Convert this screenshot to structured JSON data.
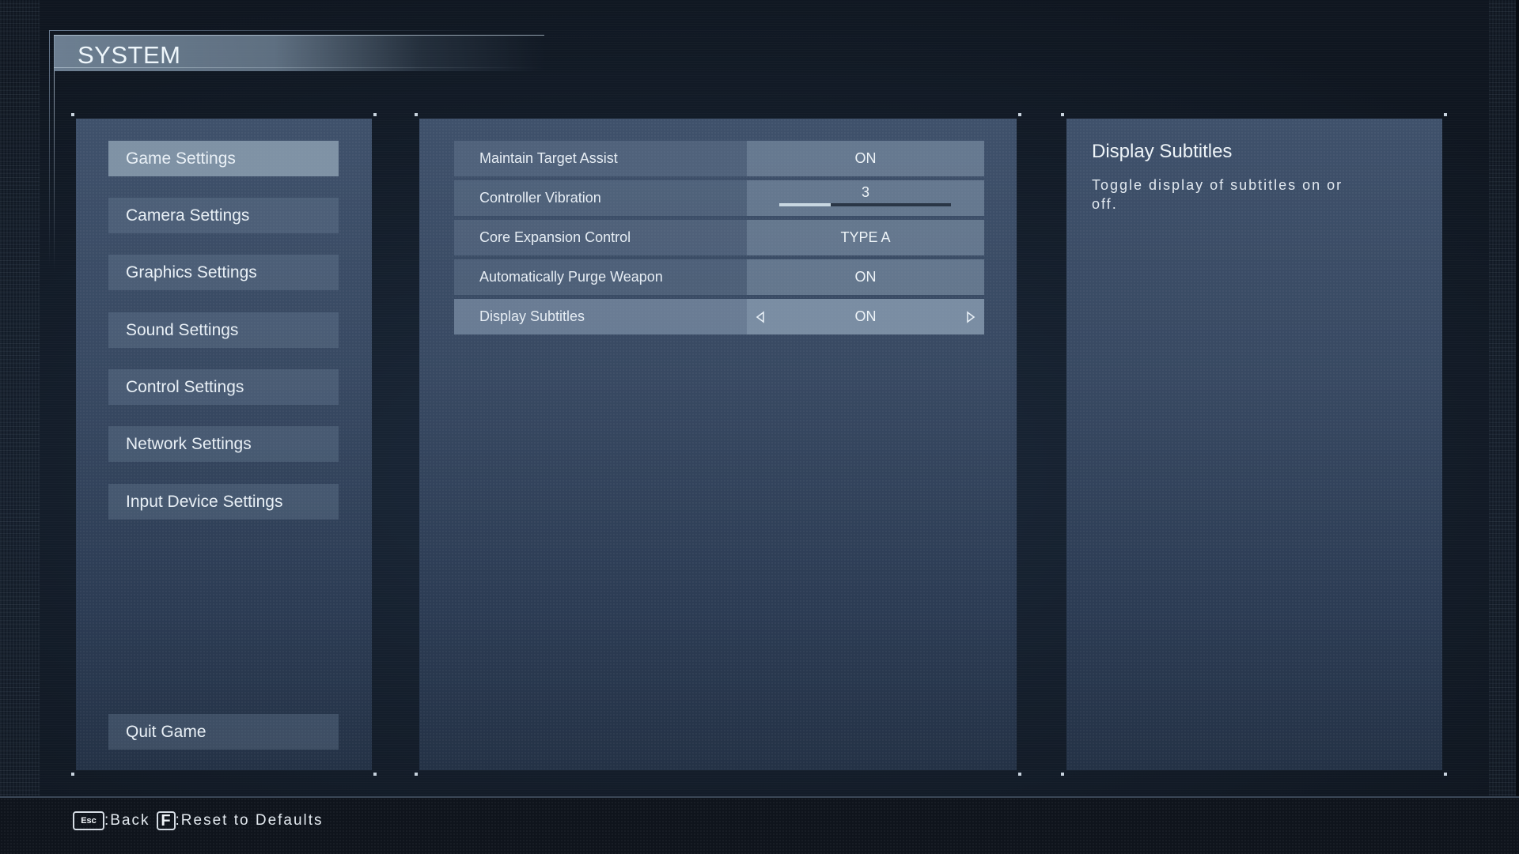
{
  "header": {
    "title": "SYSTEM"
  },
  "menu": {
    "items": [
      {
        "label": "Game Settings",
        "selected": true
      },
      {
        "label": "Camera Settings",
        "selected": false
      },
      {
        "label": "Graphics Settings",
        "selected": false
      },
      {
        "label": "Sound Settings",
        "selected": false
      },
      {
        "label": "Control Settings",
        "selected": false
      },
      {
        "label": "Network Settings",
        "selected": false
      },
      {
        "label": "Input Device Settings",
        "selected": false
      }
    ],
    "quit_label": "Quit Game"
  },
  "settings": {
    "rows": [
      {
        "label": "Maintain Target Assist",
        "type": "toggle",
        "value": "ON"
      },
      {
        "label": "Controller Vibration",
        "type": "slider",
        "value": "3",
        "level": 3,
        "max": 10
      },
      {
        "label": "Core Expansion Control",
        "type": "select",
        "value": "TYPE A"
      },
      {
        "label": "Automatically Purge Weapon",
        "type": "toggle",
        "value": "ON"
      },
      {
        "label": "Display Subtitles",
        "type": "toggle",
        "value": "ON",
        "selected": true
      }
    ],
    "arrow_left_icon": "triangle-left-outline",
    "arrow_right_icon": "triangle-right-outline"
  },
  "description": {
    "title": "Display Subtitles",
    "body": "Toggle display of subtitles on or off."
  },
  "footer": {
    "back_key": "Esc",
    "back_label": ":Back",
    "reset_key": "F",
    "reset_label": ":Reset to Defaults"
  },
  "colors": {
    "panel_top": "#3f516b",
    "panel_bottom": "#243246",
    "selected_item": "#96a8ba",
    "slider_fill": "#c9d8e2",
    "slider_track": "#2a3646",
    "background": "#141e2b"
  }
}
